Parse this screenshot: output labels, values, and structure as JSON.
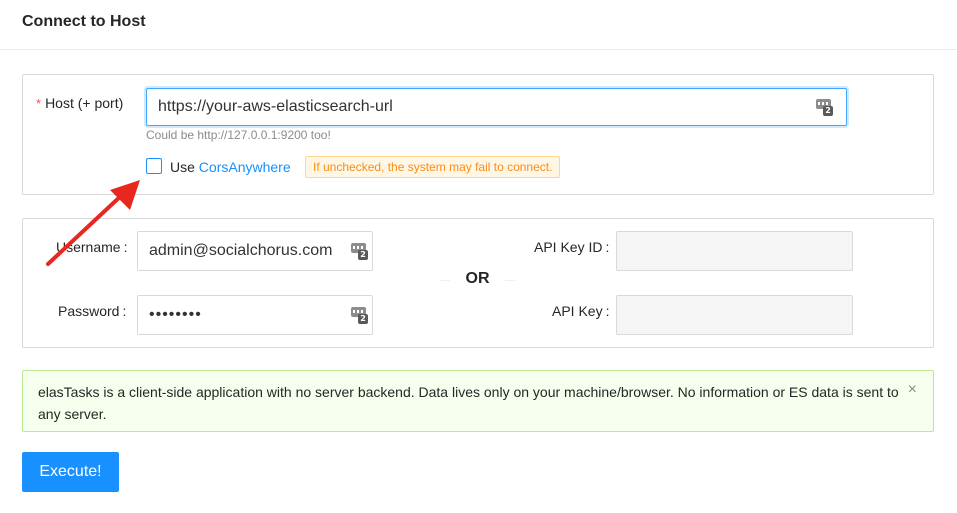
{
  "page": {
    "title": "Connect to Host"
  },
  "host": {
    "label": "Host (+ port)",
    "required_mark": "*",
    "value": "https://your-aws-elasticsearch-url",
    "help": "Could be http://127.0.0.1:9200 too!",
    "password_manager_badge": "2"
  },
  "cors": {
    "checked": false,
    "label_prefix": "Use ",
    "link_text": "CorsAnywhere",
    "warning": "If unchecked, the system may fail to connect."
  },
  "auth": {
    "username_label": "Username",
    "username_value": "admin@socialchorus.com",
    "password_label": "Password",
    "password_value": "••••••••",
    "colon": ":",
    "or_text": "OR",
    "api_key_id_label": "API Key ID",
    "api_key_id_value": "",
    "api_key_label": "API Key",
    "api_key_value": "",
    "password_manager_badge": "2"
  },
  "alert": {
    "text": "elasTasks is a client-side application with no server backend. Data lives only on your machine/browser. No information or ES data is sent to any server.",
    "close_glyph": "×"
  },
  "actions": {
    "execute_label": "Execute!"
  },
  "icons": {
    "password_manager": "password-manager-icon",
    "close": "close-icon",
    "annotation": "red-arrow"
  },
  "colors": {
    "primary": "#1890ff",
    "danger": "#ff4d4f",
    "warning": "#fa8c16",
    "success_bg": "#f6ffed",
    "arrow": "#e8271f"
  }
}
